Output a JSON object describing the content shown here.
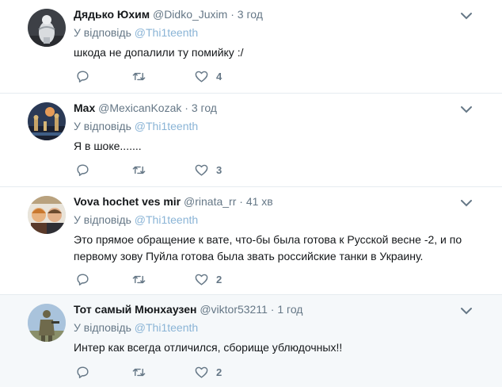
{
  "colors": {
    "handle": "#8ab4d6",
    "meta": "#657786",
    "icon": "#657786",
    "highlight_bg": "#f5f8fa"
  },
  "reply_prefix": "У відповідь",
  "tweets": [
    {
      "name": "Дядько Юхим",
      "username": "@Didko_Juxim",
      "dot": "·",
      "time": "3 год",
      "reply_to": "@Thi1teenth",
      "text": "шкода не допалили ту помийку :/",
      "likes": "4",
      "avatar_icon": "avatar-photo-monument"
    },
    {
      "name": "Max",
      "username": "@MexicanKozak",
      "dot": "·",
      "time": "3 год",
      "reply_to": "@Thi1teenth",
      "text": "Я в шоке.......",
      "likes": "3",
      "avatar_icon": "avatar-photo-night-city"
    },
    {
      "name": "Vova hochet ves mir",
      "username": "@rinata_rr",
      "dot": "·",
      "time": "41 хв",
      "reply_to": "@Thi1teenth",
      "text": "Это прямое обращение к вате, что-бы была готова к Русской весне -2, и по первому зову Пуйла готова была звать российские танки в Украину.",
      "likes": "2",
      "avatar_icon": "avatar-photo-two-people"
    },
    {
      "name": "Тот самый Мюнхаузен",
      "username": "@viktor53211",
      "dot": "·",
      "time": "1 год",
      "reply_to": "@Thi1teenth",
      "text": "Интер как всегда отличился, сборище ублюдочных!!",
      "likes": "2",
      "avatar_icon": "avatar-photo-soldier"
    }
  ]
}
